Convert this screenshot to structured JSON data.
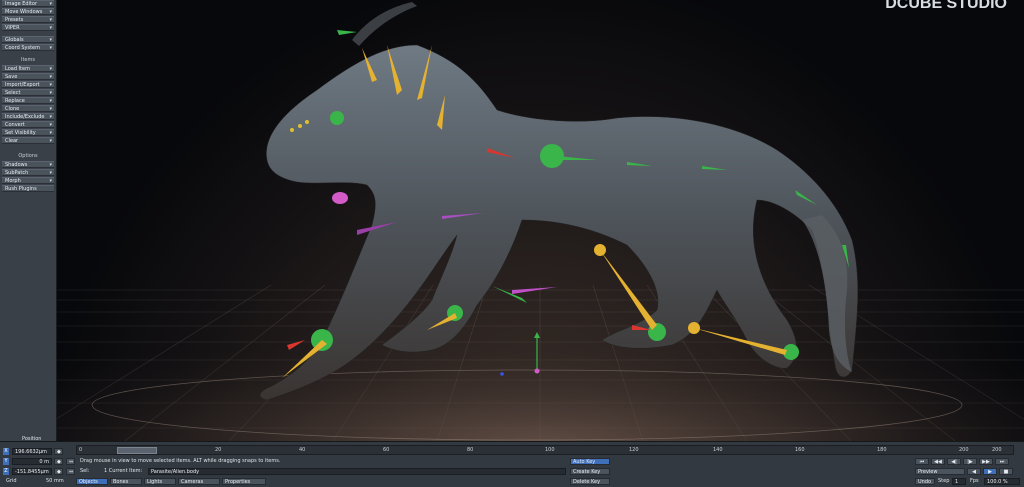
{
  "watermark": "DCUBE STUDIO",
  "left_panel": {
    "top_items": [
      "Image Editor",
      "Move Windows",
      "Presets",
      "VIPER"
    ],
    "top_items2": [
      "Globals",
      "Coord System"
    ],
    "items_heading": "Items",
    "items": [
      "Load Item",
      "Save",
      "Import/Export",
      "Select",
      "Replace",
      "Clone",
      "Include/Exclude",
      "Convert",
      "Set Visibility",
      "Clear"
    ],
    "options_heading": "Options",
    "options": [
      "Shadows",
      "SubPatch",
      "Morph",
      "Rush Plugins"
    ]
  },
  "bottom": {
    "position_label": "Position",
    "x_value": "196.6632µm",
    "y_value": "0 m",
    "z_value": "-151.8455µm",
    "grid_label": "Grid",
    "grid_value": "50 mm",
    "status_message": "Drag mouse in view to move selected items. ALT while dragging snaps to items.",
    "sel_label": "Sel:",
    "current_item_label": "1  Current Item:",
    "current_item_value": "Parasite/Alien.body",
    "mode_buttons": [
      "Objects",
      "Bones",
      "Lights",
      "Cameras",
      "Properties"
    ],
    "timeline_ticks": [
      "0",
      "20",
      "40",
      "60",
      "80",
      "100",
      "120",
      "140",
      "160",
      "180",
      "200",
      "200"
    ],
    "auto_key": "Auto Key",
    "create_key": "Create Key",
    "delete_key": "Delete Key",
    "preview": "Preview",
    "undo": "Undo",
    "step_label": "Step",
    "step_value": "1",
    "fps_label": "Fps",
    "fps_value": "100.0 %"
  }
}
